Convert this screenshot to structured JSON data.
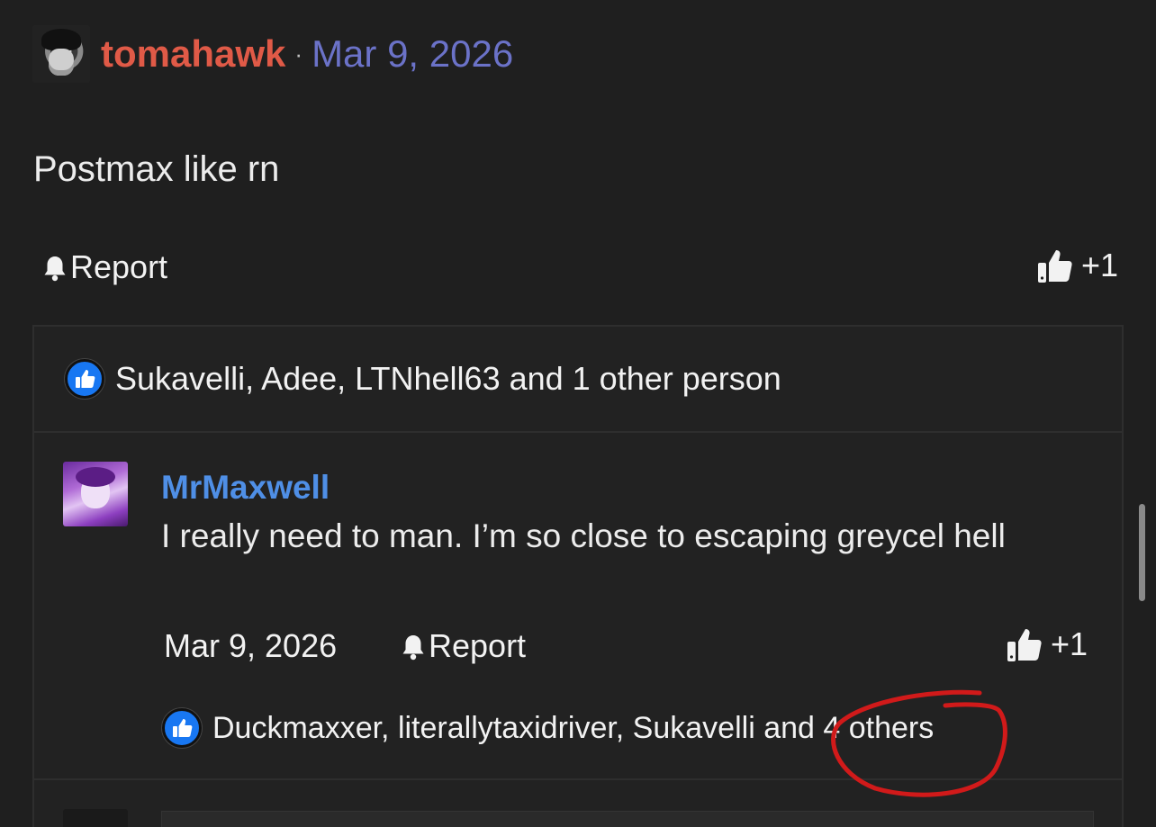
{
  "post": {
    "username": "tomahawk",
    "separator": "·",
    "date": "Mar 9, 2026",
    "body": "Postmax like rn",
    "report_label": "Report",
    "like_count": "+1",
    "likes_summary": "Sukavelli, Adee, LTNhell63 and 1 other person"
  },
  "reply": {
    "username": "MrMaxwell",
    "body": "I really need to man. I’m so close to escaping greycel hell",
    "date": "Mar 9, 2026",
    "report_label": "Report",
    "like_count": "+1",
    "likes_summary": "Duckmaxxer, literallytaxidriver, Sukavelli and 4 others"
  },
  "colors": {
    "background": "#1f1f1f",
    "username_post": "#e05a47",
    "date_post": "#6b72c8",
    "username_reply": "#4f8fe6",
    "like_badge": "#1877f2",
    "annotation": "#d11a1a"
  },
  "icons": {
    "bell": "bell-icon",
    "thumb": "thumbs-up-icon",
    "like_badge": "like-badge-icon"
  }
}
